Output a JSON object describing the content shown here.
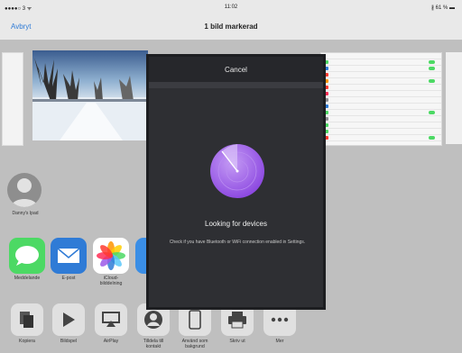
{
  "status_bar": {
    "carrier": "●●●●○ 3 ᯤ",
    "time": "11:02",
    "battery": "∦ 61 % ▬"
  },
  "nav": {
    "cancel": "Avbryt",
    "title": "1 bild markerad"
  },
  "people": [
    {
      "name": "Danny's Ipad"
    }
  ],
  "apps": [
    {
      "label": "Meddelande",
      "color": "#4cd964"
    },
    {
      "label": "E-post",
      "color": "#2f7bd6"
    },
    {
      "label": "iCloud-\nbilddelning",
      "color": "#ffffff"
    }
  ],
  "actions": [
    {
      "label": "Kopiera",
      "icon": "copy-icon"
    },
    {
      "label": "Bildspel",
      "icon": "play-icon"
    },
    {
      "label": "AirPlay",
      "icon": "airplay-icon"
    },
    {
      "label": "Tilldela till\nkontakt",
      "icon": "contact-icon"
    },
    {
      "label": "Använd som\nbakgrund",
      "icon": "ipad-icon"
    },
    {
      "label": "Skriv ut",
      "icon": "printer-icon"
    },
    {
      "label": "Mer",
      "icon": "more-icon"
    }
  ],
  "modal": {
    "cancel": "Cancel",
    "status": "Looking for devices",
    "hint": "Check if you have Bluetooth or WiFi connection enabled in Settings.",
    "accent": "#9b59e8"
  }
}
